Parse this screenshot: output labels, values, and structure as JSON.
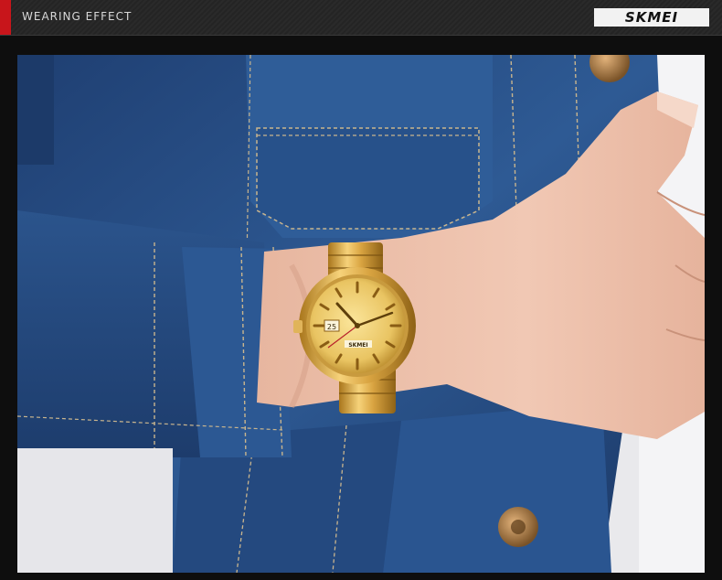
{
  "header": {
    "title": "WEARING EFFECT",
    "brand": "SKMEI",
    "accent_color": "#c8151b"
  },
  "photo": {
    "watch_brand_on_dial": "SKMEI",
    "date_window": "25"
  }
}
